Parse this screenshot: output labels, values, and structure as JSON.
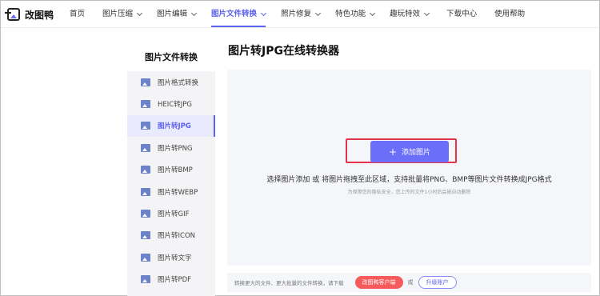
{
  "app": {
    "name": "改图鸭"
  },
  "nav": {
    "items": [
      {
        "label": "首页",
        "dropdown": false,
        "active": false
      },
      {
        "label": "图片压缩",
        "dropdown": true,
        "active": false
      },
      {
        "label": "图片编辑",
        "dropdown": true,
        "active": false
      },
      {
        "label": "图片文件转换",
        "dropdown": true,
        "active": true
      },
      {
        "label": "照片修复",
        "dropdown": true,
        "active": false
      },
      {
        "label": "特色功能",
        "dropdown": true,
        "active": false
      },
      {
        "label": "趣玩特效",
        "dropdown": true,
        "active": false
      },
      {
        "label": "下载中心",
        "dropdown": false,
        "active": false
      },
      {
        "label": "使用帮助",
        "dropdown": false,
        "active": false
      }
    ]
  },
  "sidebar": {
    "title": "图片文件转换",
    "items": [
      {
        "label": "图片格式转换",
        "active": false
      },
      {
        "label": "HEIC转JPG",
        "active": false
      },
      {
        "label": "图片转JPG",
        "active": true
      },
      {
        "label": "图片转PNG",
        "active": false
      },
      {
        "label": "图片转BMP",
        "active": false
      },
      {
        "label": "图片转WEBP",
        "active": false
      },
      {
        "label": "图片转GIF",
        "active": false
      },
      {
        "label": "图片转ICON",
        "active": false
      },
      {
        "label": "图片转文字",
        "active": false
      },
      {
        "label": "图片转PDF",
        "active": false
      }
    ]
  },
  "main": {
    "title": "图片转JPG在线转换器",
    "add_button": {
      "plus": "+",
      "label": "添加图片"
    },
    "description": "选择图片添加 或 将图片拖拽至此区域，支持批量将PNG、BMP等图片文件转换成JPG格式",
    "note": "为保障您的隐私安全，您上传的文件1小时后会被自动删除"
  },
  "bottom": {
    "text": "转换更大的文件、更大批量的文件转换，请下载",
    "client_button": "改图鸭客户端",
    "or": "或",
    "upgrade_button": "升级账户"
  },
  "colors": {
    "accent": "#5b61f0",
    "button": "#6b6ef8",
    "highlight_border": "#e5334b",
    "client_button": "#f75a5a"
  }
}
